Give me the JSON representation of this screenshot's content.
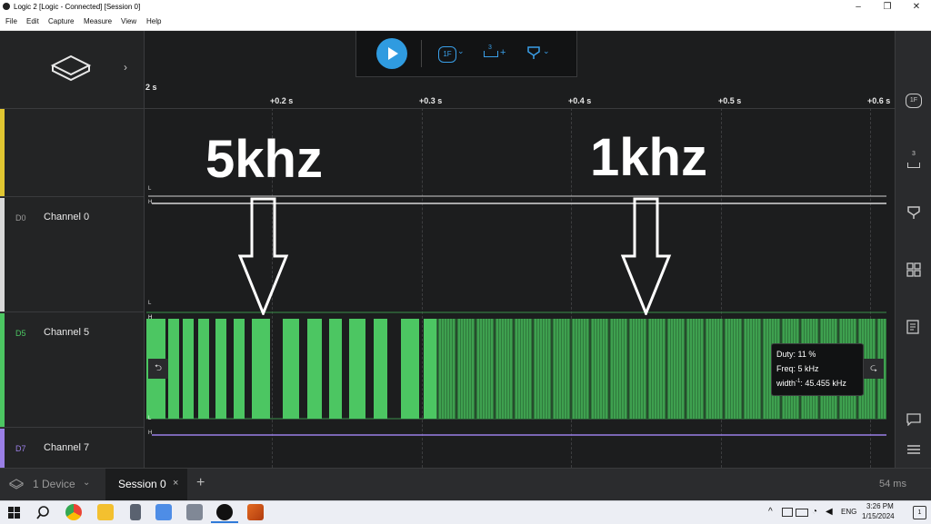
{
  "window": {
    "title": "Logic 2 [Logic - Connected] [Session 0]",
    "minimize": "–",
    "maximize": "❐",
    "close": "✕"
  },
  "menu": [
    "File",
    "Edit",
    "Capture",
    "Measure",
    "View",
    "Help"
  ],
  "toolbar": {
    "analyzer_icon": "1F",
    "measure_badge": "3",
    "plus": "+",
    "dropdown": "⌄"
  },
  "timeline": {
    "start_tick": "2 s",
    "ticks": [
      "+0.2 s",
      "+0.3 s",
      "+0.4 s",
      "+0.5 s",
      "+0.6 s"
    ]
  },
  "channels": [
    {
      "id": "D0",
      "name": "Channel 0",
      "color": "#d8d8d8"
    },
    {
      "id": "D5",
      "name": "Channel 5",
      "color": "#4cc662"
    },
    {
      "id": "D7",
      "name": "Channel 7",
      "color": "#9a7fe6"
    }
  ],
  "trace_markers": {
    "high": "H",
    "low": "L"
  },
  "top_channel_color": "#e0c631",
  "annotations": {
    "left_label": "5khz",
    "right_label": "1khz"
  },
  "measurement": {
    "duty": "Duty: 11 %",
    "freq": "Freq: 5 kHz",
    "width_prefix": "width",
    "width_sup": "-1",
    "width_value": ": 45.455 kHz"
  },
  "tabs": {
    "device": "1 Device",
    "session": "Session 0",
    "close": "×",
    "add": "+",
    "duration": "54 ms"
  },
  "taskbar": {
    "lang": "ENG",
    "time": "3:26 PM",
    "date": "1/15/2024",
    "notif_count": "1"
  },
  "colors": {
    "accent": "#2f9be0",
    "signal_green": "#4cc662",
    "background": "#1c1d1e"
  }
}
